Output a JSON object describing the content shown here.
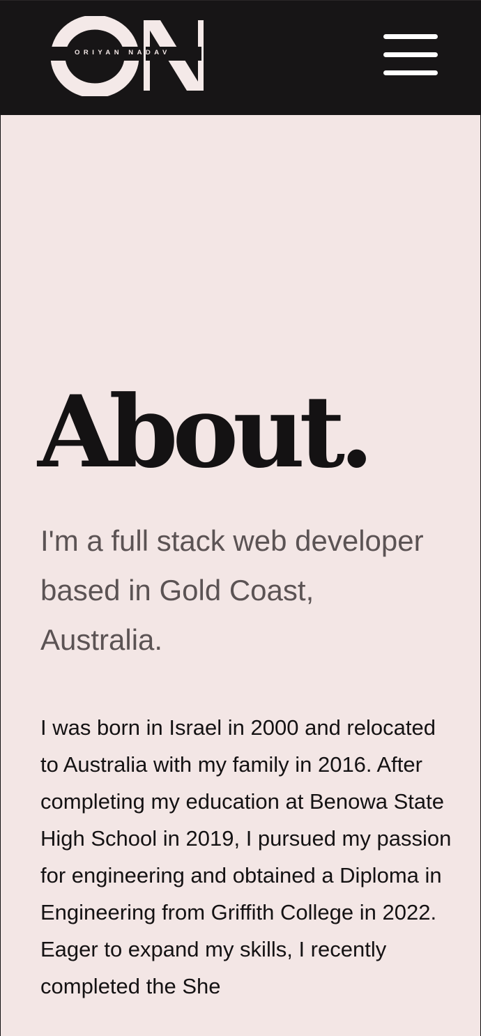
{
  "header": {
    "logo_letters": "ON",
    "logo_name": "ORIYAN NADAV",
    "menu_icon": "hamburger-menu-icon"
  },
  "about": {
    "title": "About.",
    "tagline": "I'm a full stack web developer based in Gold Coast, Australia.",
    "bio": "I was born in Israel in 2000 and relocated to Australia with my family in 2016. After completing my education at Benowa State High School in 2019, I pursued my passion for engineering and obtained a Diploma in Engineering from Griffith College in 2022. Eager to expand my skills, I recently completed the She"
  },
  "colors": {
    "header_bg": "#171516",
    "page_bg": "#f3e6e5",
    "title_text": "#141213",
    "tagline_text": "#5b5354",
    "logo": "#f4e9e8"
  }
}
